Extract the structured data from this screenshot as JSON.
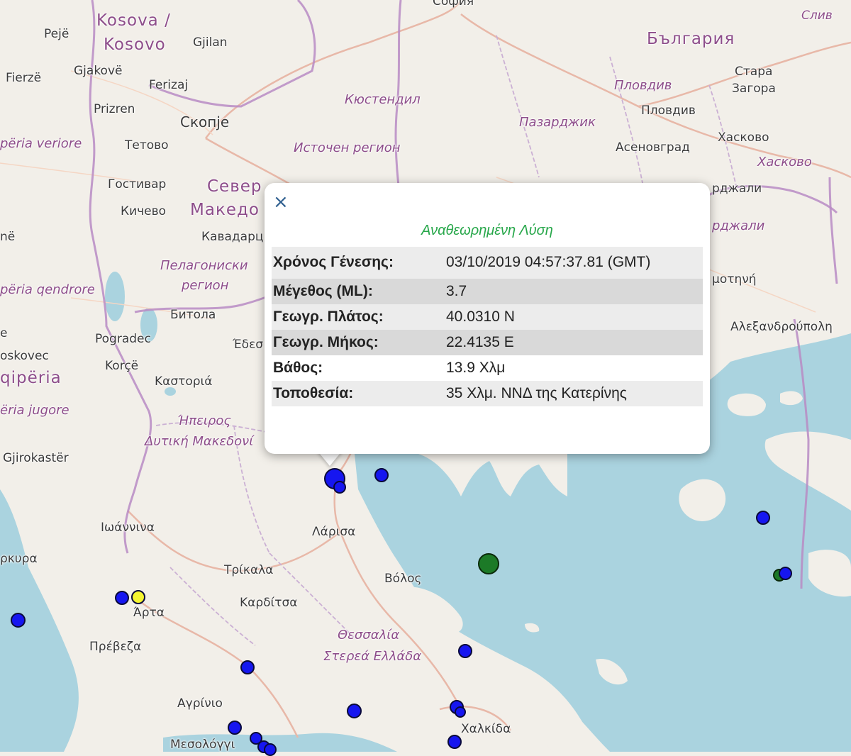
{
  "map": {
    "colors": {
      "land": "#f2efe9",
      "sea": "#aad3df",
      "border": "#b98bc4",
      "road": "#e8b8a8",
      "marker_blue": "#1616f0",
      "marker_yellow": "#f5f531",
      "marker_green": "#1c7a27"
    },
    "labels": {
      "sofia": "София",
      "slive": "Слив",
      "kosova": "Kosova /",
      "kosovo": "Kosovo",
      "peje": "Pejë",
      "gjilan": "Gjilan",
      "bulgaria": "България",
      "stara": "Стара",
      "zagora": "Загора",
      "plovdiv_region": "Пловдив",
      "plovdiv": "Пловдив",
      "fierze": "Fierzë",
      "gjakove": "Gjakovë",
      "ferizaj": "Ferizaj",
      "kyustendil": "Кюстендил",
      "prizren": "Prizren",
      "skopje": "Скопје",
      "pazardzhik": "Пазарджик",
      "haskovo": "Хасково",
      "haskovo_region": "Хасково",
      "veriore": "përia veriore",
      "tetovo": "Тетово",
      "iztochen": "Источен регион",
      "asenovgrad": "Асеновград",
      "gostivar": "Гостивар",
      "severna": "Север",
      "kardzhali1": "рджали",
      "kichevo": "Кичево",
      "makedonija": "Македо",
      "kardzhali2": "рджали",
      "ne": "në",
      "kavadarci": "Кавадарц",
      "pelagonia1": "Пелагониски",
      "pelagonia2": "регион",
      "qendrore": "përia qendrore",
      "komotini": "μοτηνή",
      "bitola": "Битола",
      "e": "e",
      "pogradec": "Pogradec",
      "alexandroupoli": "Αλεξανδρούπολη",
      "edessa": "Έδεσ",
      "oskovec": "oskovec",
      "korce": "Korçë",
      "shqiperia": "qipëria",
      "kastoria": "Καστοριά",
      "jugore": "ëria jugore",
      "ipeiros": "Ήπειρος",
      "dytiki": "Δυτική Μακεδονί",
      "gjirokaster": "Gjirokastër",
      "ioannina": "Ιωάννινα",
      "larisa": "Λάρισα",
      "kerkyra": "ρκυρα",
      "trikala": "Τρίκαλα",
      "volos": "Βόλος",
      "karditsa": "Καρδίτσα",
      "arta": "Άρτα",
      "thessalia": "Θεσσαλία",
      "sterea": "Στερεά Ελλάδα",
      "preveza": "Πρέβεζα",
      "agrinio": "Αγρίνιο",
      "chalkida": "Χαλκίδα",
      "mesolongi": "Μεσολόγγι"
    },
    "markers": [
      {
        "id": "m1",
        "lat": 40.031,
        "lon": 22.414,
        "color": "blue",
        "size": "large"
      },
      {
        "id": "m2",
        "color": "blue",
        "size": "small"
      },
      {
        "id": "m3",
        "color": "blue",
        "size": "small"
      },
      {
        "id": "m4",
        "color": "green",
        "size": "large"
      },
      {
        "id": "m5",
        "color": "blue",
        "size": "small"
      },
      {
        "id": "m6",
        "color": "green",
        "size": "small"
      },
      {
        "id": "m7",
        "color": "blue",
        "size": "small"
      },
      {
        "id": "m8",
        "color": "blue",
        "size": "small"
      },
      {
        "id": "m9",
        "color": "yellow",
        "size": "small"
      },
      {
        "id": "m10",
        "color": "blue",
        "size": "small"
      },
      {
        "id": "m11",
        "color": "blue",
        "size": "small"
      },
      {
        "id": "m12",
        "color": "blue",
        "size": "small"
      },
      {
        "id": "m13",
        "color": "blue",
        "size": "small"
      },
      {
        "id": "m14",
        "color": "blue",
        "size": "small"
      },
      {
        "id": "m15",
        "color": "blue",
        "size": "small"
      },
      {
        "id": "m16",
        "color": "blue",
        "size": "small"
      },
      {
        "id": "m17",
        "color": "blue",
        "size": "small"
      },
      {
        "id": "m18",
        "color": "blue",
        "size": "small"
      },
      {
        "id": "m19",
        "color": "blue",
        "size": "small"
      },
      {
        "id": "m20",
        "color": "blue",
        "size": "small"
      }
    ]
  },
  "popup": {
    "close_icon": "×",
    "title": "Αναθεωρημένη Λύση",
    "rows": [
      {
        "key": "Χρόνος Γένεσης:",
        "value": "03/10/2019 04:57:37.81 (GMT)"
      },
      {
        "key": "Μέγεθος (ML):",
        "value": "3.7"
      },
      {
        "key": "Γεωγρ. Πλάτος:",
        "value": "40.0310 N"
      },
      {
        "key": "Γεωγρ. Μήκος:",
        "value": "22.4135 E"
      },
      {
        "key": "Βάθος:",
        "value": "13.9 Χλμ"
      },
      {
        "key": "Τοποθεσία:",
        "value": "35 Χλμ. ΝΝΔ της Κατερίνης"
      }
    ]
  }
}
